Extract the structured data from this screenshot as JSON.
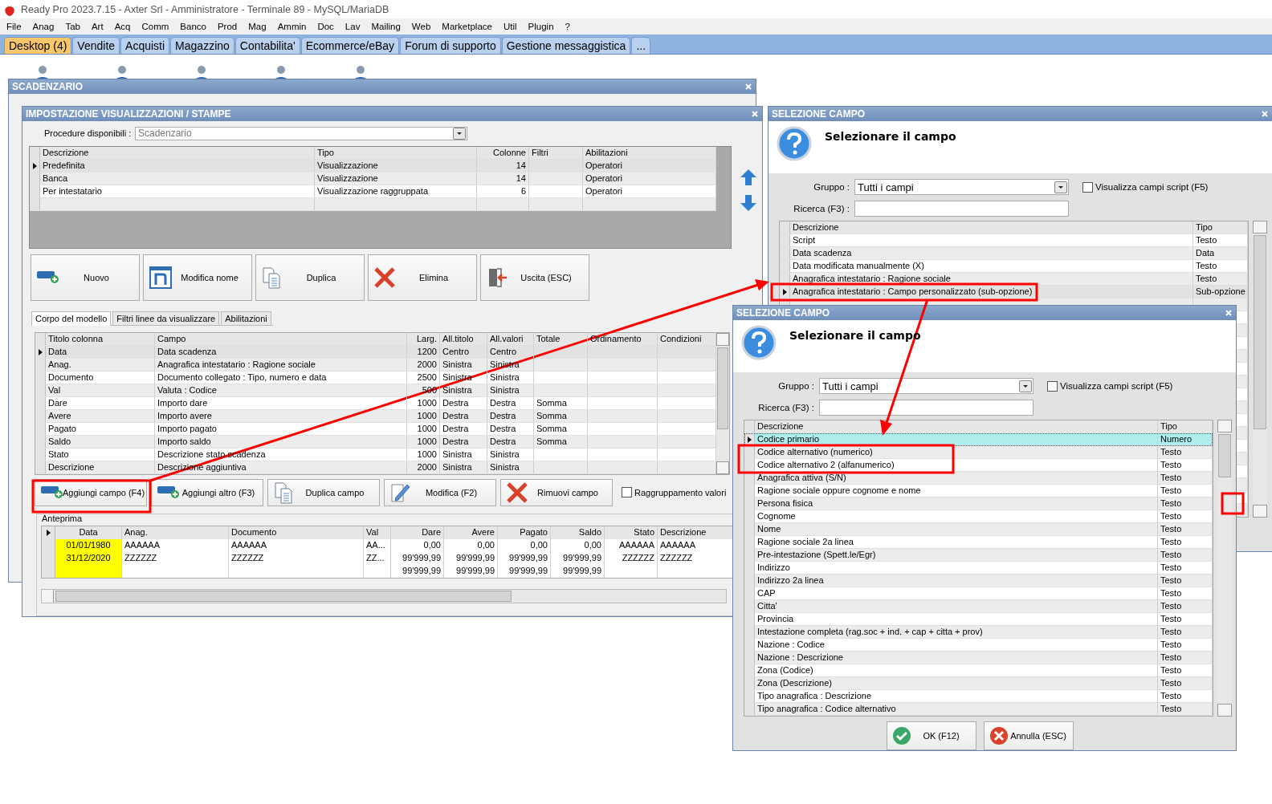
{
  "app_title": "Ready Pro 2023.7.15 - Axter Srl - Amministratore - Terminale 89 - MySQL/MariaDB",
  "menu": [
    "File",
    "Anag",
    "Tab",
    "Art",
    "Acq",
    "Comm",
    "Banco",
    "Prod",
    "Mag",
    "Ammin",
    "Doc",
    "Lav",
    "Mailing",
    "Web",
    "Marketplace",
    "Util",
    "Plugin",
    "?"
  ],
  "tabs": [
    {
      "label": "Desktop (4)",
      "selected": true
    },
    {
      "label": "Vendite",
      "selected": false
    },
    {
      "label": "Acquisti",
      "selected": false
    },
    {
      "label": "Magazzino",
      "selected": false
    },
    {
      "label": "Contabilita'",
      "selected": false
    },
    {
      "label": "Ecommerce/eBay",
      "selected": false
    },
    {
      "label": "Forum di supporto",
      "selected": false
    },
    {
      "label": "Gestione messaggistica",
      "selected": false
    },
    {
      "label": "...",
      "selected": false
    }
  ],
  "scadenzario": {
    "title": "SCADENZARIO"
  },
  "impostazione": {
    "title": "IMPOSTAZIONE VISUALIZZAZIONI / STAMPE",
    "procedure_label": "Procedure disponibili :",
    "procedure_value": "Scadenzario",
    "models": {
      "columns": [
        "Descrizione",
        "Tipo",
        "Colonne",
        "Filtri",
        "Abilitazioni"
      ],
      "rows": [
        {
          "cells": [
            "Predefinita",
            "Visualizzazione",
            "14",
            "",
            "Operatori"
          ],
          "selected": true
        },
        {
          "cells": [
            "Banca",
            "Visualizzazione",
            "14",
            "",
            "Operatori"
          ],
          "selected": false
        },
        {
          "cells": [
            "Per intestatario",
            "Visualizzazione raggruppata",
            "6",
            "",
            "Operatori"
          ],
          "selected": false
        }
      ]
    },
    "buttons": [
      {
        "label": "Nuovo",
        "kind": "add"
      },
      {
        "label": "Modifica nome",
        "kind": "rename"
      },
      {
        "label": "Duplica",
        "kind": "copy"
      },
      {
        "label": "Elimina",
        "kind": "delete"
      },
      {
        "label": "Uscita (ESC)",
        "kind": "exit"
      }
    ],
    "subtabs": [
      {
        "label": "Corpo del modello",
        "selected": true
      },
      {
        "label": "Filtri linee da visualizzare",
        "selected": false
      },
      {
        "label": "Abilitazioni",
        "selected": false
      }
    ],
    "fields": {
      "columns": [
        "Titolo colonna",
        "Campo",
        "Larg.",
        "All.titolo",
        "All.valori",
        "Totale",
        "Ordinamento",
        "Condizioni"
      ],
      "rows": [
        {
          "cells": [
            "Data",
            "Data scadenza",
            "1200",
            "Centro",
            "Centro",
            "",
            "",
            ""
          ],
          "selected": true
        },
        {
          "cells": [
            "Anag.",
            "Anagrafica intestatario : Ragione sociale",
            "2000",
            "Sinistra",
            "Sinistra",
            "",
            "",
            ""
          ],
          "selected": false
        },
        {
          "cells": [
            "Documento",
            "Documento collegato : Tipo, numero e data",
            "2500",
            "Sinistra",
            "Sinistra",
            "",
            "",
            ""
          ],
          "selected": false
        },
        {
          "cells": [
            "Val",
            "Valuta : Codice",
            "500",
            "Sinistra",
            "Sinistra",
            "",
            "",
            ""
          ],
          "selected": false
        },
        {
          "cells": [
            "Dare",
            "Importo dare",
            "1000",
            "Destra",
            "Destra",
            "Somma",
            "",
            ""
          ],
          "selected": false
        },
        {
          "cells": [
            "Avere",
            "Importo avere",
            "1000",
            "Destra",
            "Destra",
            "Somma",
            "",
            ""
          ],
          "selected": false
        },
        {
          "cells": [
            "Pagato",
            "Importo pagato",
            "1000",
            "Destra",
            "Destra",
            "Somma",
            "",
            ""
          ],
          "selected": false
        },
        {
          "cells": [
            "Saldo",
            "Importo saldo",
            "1000",
            "Destra",
            "Destra",
            "Somma",
            "",
            ""
          ],
          "selected": false
        },
        {
          "cells": [
            "Stato",
            "Descrizione stato scadenza",
            "1000",
            "Sinistra",
            "Sinistra",
            "",
            "",
            ""
          ],
          "selected": false
        },
        {
          "cells": [
            "Descrizione",
            "Descrizione aggiuntiva",
            "2000",
            "Sinistra",
            "Sinistra",
            "",
            "",
            ""
          ],
          "selected": false
        }
      ]
    },
    "field_buttons": [
      {
        "label": "Aggiungi campo (F4)",
        "kind": "add"
      },
      {
        "label": "Aggiungi altro (F3)",
        "kind": "add"
      },
      {
        "label": "Duplica campo",
        "kind": "copy"
      },
      {
        "label": "Modifica (F2)",
        "kind": "edit"
      },
      {
        "label": "Rimuovi campo",
        "kind": "delete"
      }
    ],
    "group_checkbox": {
      "label": "Raggruppamento valori",
      "checked": false
    },
    "preview": {
      "title": "Anteprima",
      "columns": [
        "Data",
        "Anag.",
        "Documento",
        "Val",
        "Dare",
        "Avere",
        "Pagato",
        "Saldo",
        "Stato",
        "Descrizione"
      ],
      "rows": [
        [
          "01/01/1980",
          "AAAAAA",
          "AAAAAA",
          "AA...",
          "0,00",
          "0,00",
          "0,00",
          "0,00",
          "AAAAAA",
          "AAAAAA"
        ],
        [
          "31/12/2020",
          "ZZZZZZ",
          "ZZZZZZ",
          "ZZ...",
          "99'999,99",
          "99'999,99",
          "99'999,99",
          "99'999,99",
          "ZZZZZZ",
          "ZZZZZZ"
        ]
      ],
      "totals": [
        "99'999,99",
        "99'999,99",
        "99'999,99",
        "99'999,99"
      ]
    }
  },
  "selection_windows": [
    {
      "title": "SELEZIONE CAMPO",
      "heading": "Selezionare il campo",
      "focused": false,
      "group_label": "Gruppo :",
      "group_value": "Tutti i campi",
      "script_label": "Visualizza campi script (F5)",
      "script_checked": false,
      "search_label": "Ricerca (F3) :",
      "columns": [
        "Descrizione",
        "Tipo"
      ],
      "rows": [
        {
          "cells": [
            "Script",
            "Testo"
          ],
          "selected": false
        },
        {
          "cells": [
            "Data scadenza",
            "Data"
          ],
          "selected": false
        },
        {
          "cells": [
            "Data modificata manualmente (X)",
            "Testo"
          ],
          "selected": false
        },
        {
          "cells": [
            "Anagrafica intestatario : Ragione sociale",
            "Testo"
          ],
          "selected": false
        },
        {
          "cells": [
            "Anagrafica intestatario : Campo personalizzato (sub-opzione)",
            "Sub-opzione"
          ],
          "selected": true
        }
      ]
    },
    {
      "title": "SELEZIONE CAMPO",
      "heading": "Selezionare il campo",
      "focused": true,
      "group_label": "Gruppo :",
      "group_value": "Tutti i campi",
      "script_label": "Visualizza campi script (F5)",
      "script_checked": false,
      "search_label": "Ricerca (F3) :",
      "columns": [
        "Descrizione",
        "Tipo"
      ],
      "rows": [
        {
          "cells": [
            "Codice primario",
            "Numero"
          ],
          "selected": true
        },
        {
          "cells": [
            "Codice alternativo (numerico)",
            "Testo"
          ],
          "selected": false
        },
        {
          "cells": [
            "Codice alternativo 2 (alfanumerico)",
            "Testo"
          ],
          "selected": false
        },
        {
          "cells": [
            "Anagrafica attiva (S/N)",
            "Testo"
          ],
          "selected": false
        },
        {
          "cells": [
            "Ragione sociale oppure cognome e nome",
            "Testo"
          ],
          "selected": false
        },
        {
          "cells": [
            "Persona fisica",
            "Testo"
          ],
          "selected": false
        },
        {
          "cells": [
            "Cognome",
            "Testo"
          ],
          "selected": false
        },
        {
          "cells": [
            "Nome",
            "Testo"
          ],
          "selected": false
        },
        {
          "cells": [
            "Ragione sociale 2a linea",
            "Testo"
          ],
          "selected": false
        },
        {
          "cells": [
            "Pre-intestazione (Spett.le/Egr)",
            "Testo"
          ],
          "selected": false
        },
        {
          "cells": [
            "Indirizzo",
            "Testo"
          ],
          "selected": false
        },
        {
          "cells": [
            "Indirizzo 2a linea",
            "Testo"
          ],
          "selected": false
        },
        {
          "cells": [
            "CAP",
            "Testo"
          ],
          "selected": false
        },
        {
          "cells": [
            "Citta'",
            "Testo"
          ],
          "selected": false
        },
        {
          "cells": [
            "Provincia",
            "Testo"
          ],
          "selected": false
        },
        {
          "cells": [
            "Intestazione completa (rag.soc + ind. + cap + citta + prov)",
            "Testo"
          ],
          "selected": false
        },
        {
          "cells": [
            "Nazione : Codice",
            "Testo"
          ],
          "selected": false
        },
        {
          "cells": [
            "Nazione : Descrizione",
            "Testo"
          ],
          "selected": false
        },
        {
          "cells": [
            "Zona (Codice)",
            "Testo"
          ],
          "selected": false
        },
        {
          "cells": [
            "Zona (Descrizione)",
            "Testo"
          ],
          "selected": false
        },
        {
          "cells": [
            "Tipo anagrafica : Descrizione",
            "Testo"
          ],
          "selected": false
        },
        {
          "cells": [
            "Tipo anagrafica : Codice alternativo",
            "Testo"
          ],
          "selected": false
        }
      ],
      "buttons": [
        {
          "label": "OK (F12)",
          "kind": "ok"
        },
        {
          "label": "Annulla (ESC)",
          "kind": "cancel"
        }
      ]
    }
  ]
}
